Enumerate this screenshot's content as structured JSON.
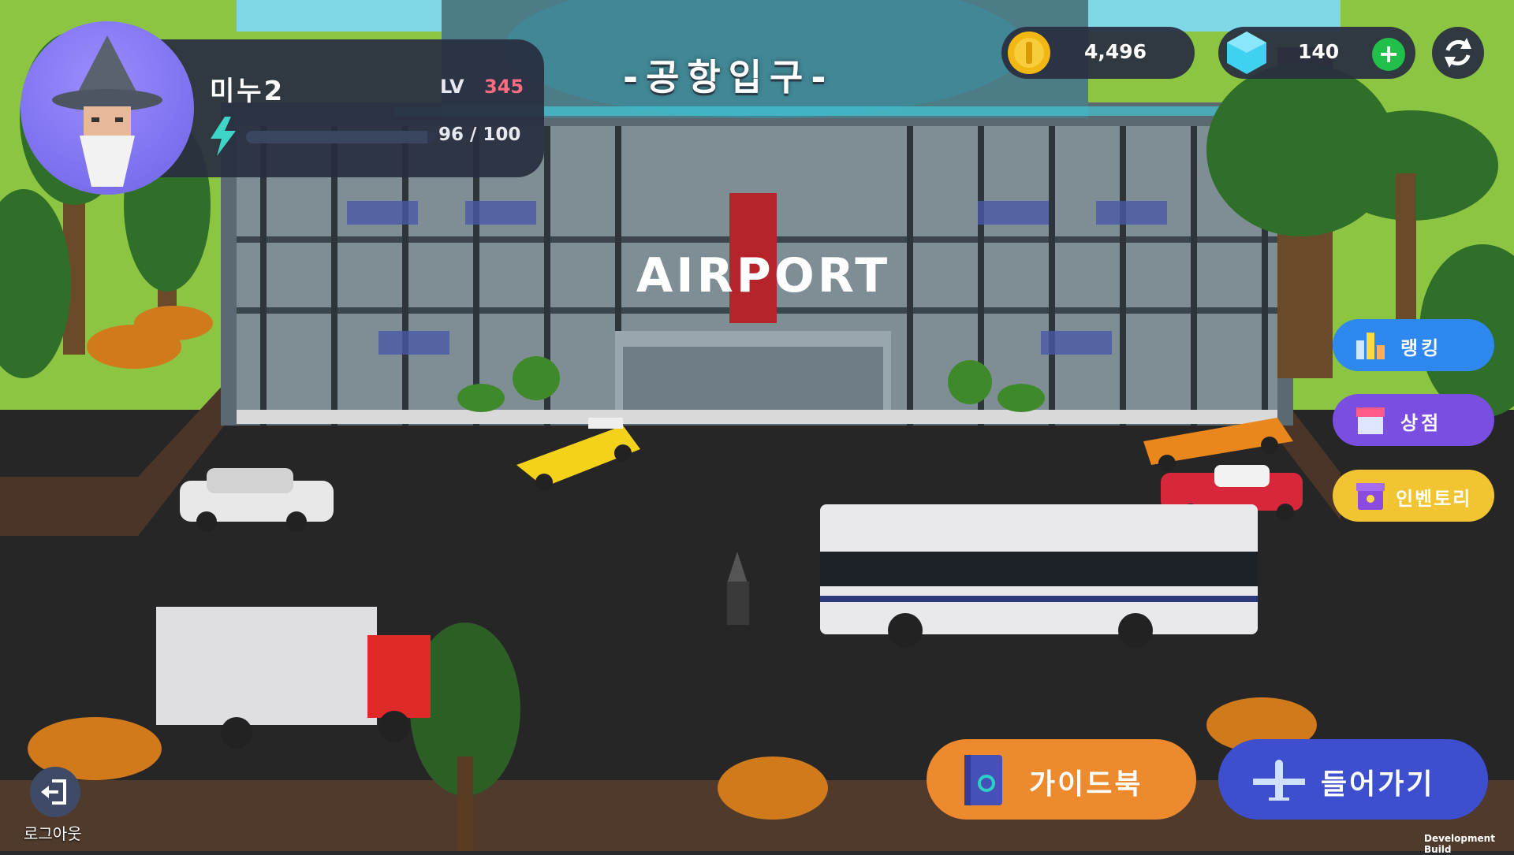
{
  "hud": {
    "player_name": "미누2",
    "level_label": "LV",
    "level_value": "345",
    "energy_text": "96 / 100",
    "energy_fraction": 0.96
  },
  "location_title": "-공항입구-",
  "scene": {
    "building_sign": "AIRPORT"
  },
  "currency": {
    "coins": "4,496",
    "gems": "140",
    "add_label": "+"
  },
  "menu": {
    "ranking": "랭킹",
    "shop": "상점",
    "inventory": "인벤토리"
  },
  "bottom": {
    "guidebook": "가이드북",
    "enter": "들어가기",
    "logout": "로그아웃"
  },
  "footer": {
    "dev_build": "Development Build"
  },
  "colors": {
    "ranking_button": "#2f87f0",
    "shop_button": "#7a4ee0",
    "inventory_button": "#f2c431",
    "guide_button": "#ee8a2e",
    "enter_button": "#3d4fcf",
    "level_value": "#ff6b81",
    "add_button": "#20c04a"
  }
}
